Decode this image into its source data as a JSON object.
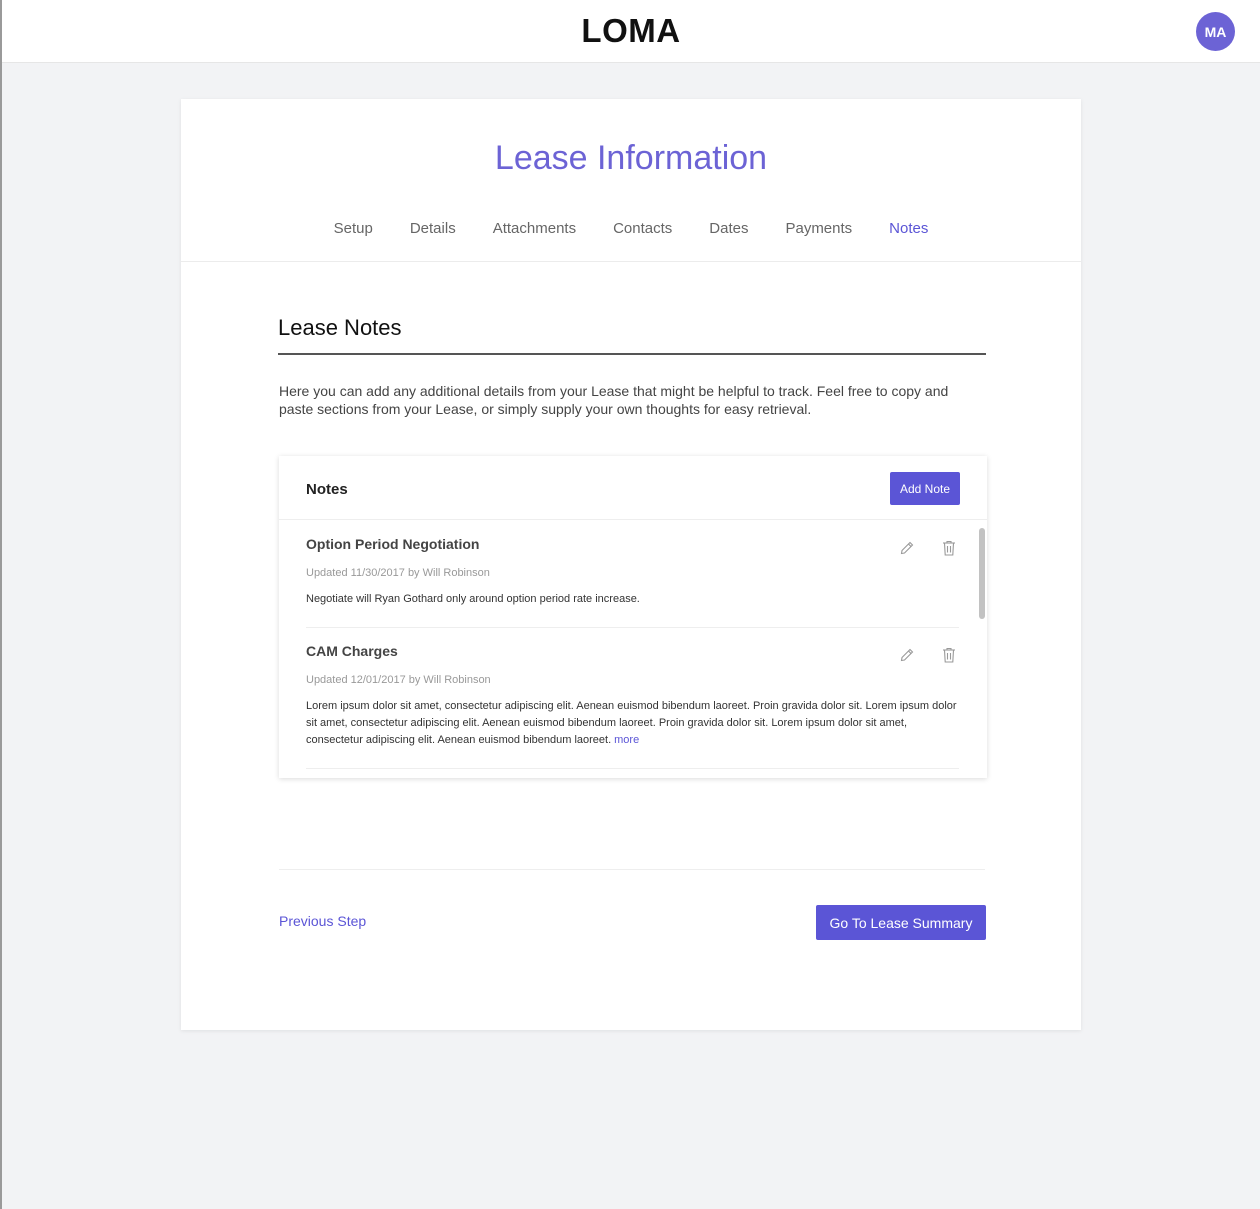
{
  "header": {
    "logo": "LOMA",
    "avatar_initials": "MA"
  },
  "page": {
    "title": "Lease Information",
    "tabs": [
      {
        "label": "Setup",
        "active": false
      },
      {
        "label": "Details",
        "active": false
      },
      {
        "label": "Attachments",
        "active": false
      },
      {
        "label": "Contacts",
        "active": false
      },
      {
        "label": "Dates",
        "active": false
      },
      {
        "label": "Payments",
        "active": false
      },
      {
        "label": "Notes",
        "active": true
      }
    ]
  },
  "section": {
    "title": "Lease Notes",
    "intro": "Here you can add any additional details from your Lease that might be helpful to track. Feel free to copy and paste sections from your Lease, or simply supply your own thoughts for easy retrieval."
  },
  "notes_panel": {
    "title": "Notes",
    "add_label": "Add Note",
    "notes": [
      {
        "title": "Option Period Negotiation",
        "meta": "Updated 11/30/2017 by Will Robinson",
        "body": "Negotiate will Ryan Gothard only around option period rate increase."
      },
      {
        "title": "CAM Charges",
        "meta": "Updated 12/01/2017 by Will Robinson",
        "body": "Lorem ipsum dolor sit amet, consectetur adipiscing elit. Aenean euismod bibendum laoreet. Proin gravida dolor sit. Lorem ipsum dolor sit amet, consectetur adipiscing elit. Aenean euismod bibendum laoreet. Proin gravida dolor sit. Lorem ipsum dolor sit amet, consectetur adipiscing elit. Aenean euismod bibendum laoreet.",
        "more_label": "more"
      }
    ]
  },
  "footer": {
    "prev_label": "Previous Step",
    "next_label": "Go To Lease Summary"
  },
  "colors": {
    "accent": "#5b55d6",
    "avatar": "#6c63d5",
    "background": "#f2f3f5"
  },
  "icons": {
    "edit": "pencil-icon",
    "delete": "trash-icon"
  }
}
